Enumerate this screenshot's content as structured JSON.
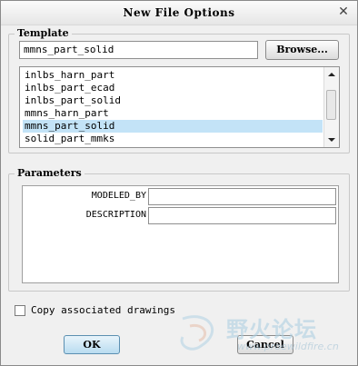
{
  "window": {
    "title": "New File Options"
  },
  "template": {
    "group_label": "Template",
    "selected_value": "mmns_part_solid",
    "browse_label": "Browse...",
    "list": [
      {
        "label": "inlbs_harn_part",
        "selected": false
      },
      {
        "label": "inlbs_part_ecad",
        "selected": false
      },
      {
        "label": "inlbs_part_solid",
        "selected": false
      },
      {
        "label": "mmns_harn_part",
        "selected": false
      },
      {
        "label": "mmns_part_solid",
        "selected": true
      },
      {
        "label": "solid_part_mmks",
        "selected": false
      }
    ]
  },
  "parameters": {
    "group_label": "Parameters",
    "fields": [
      {
        "label": "MODELED_BY",
        "value": ""
      },
      {
        "label": "DESCRIPTION",
        "value": ""
      }
    ]
  },
  "copy_drawings": {
    "label": "Copy associated drawings",
    "checked": false
  },
  "buttons": {
    "ok": "OK",
    "cancel": "Cancel"
  },
  "watermark": {
    "text": "野火论坛",
    "url": "www.proewildfire.cn"
  },
  "colors": {
    "selection": "#c3e3f7",
    "watermark": "#aed0e2"
  },
  "icons": {
    "close": "close-icon",
    "scroll_up": "scroll-up-icon",
    "scroll_down": "scroll-down-icon",
    "watermark_logo": "watermark-logo-icon"
  }
}
